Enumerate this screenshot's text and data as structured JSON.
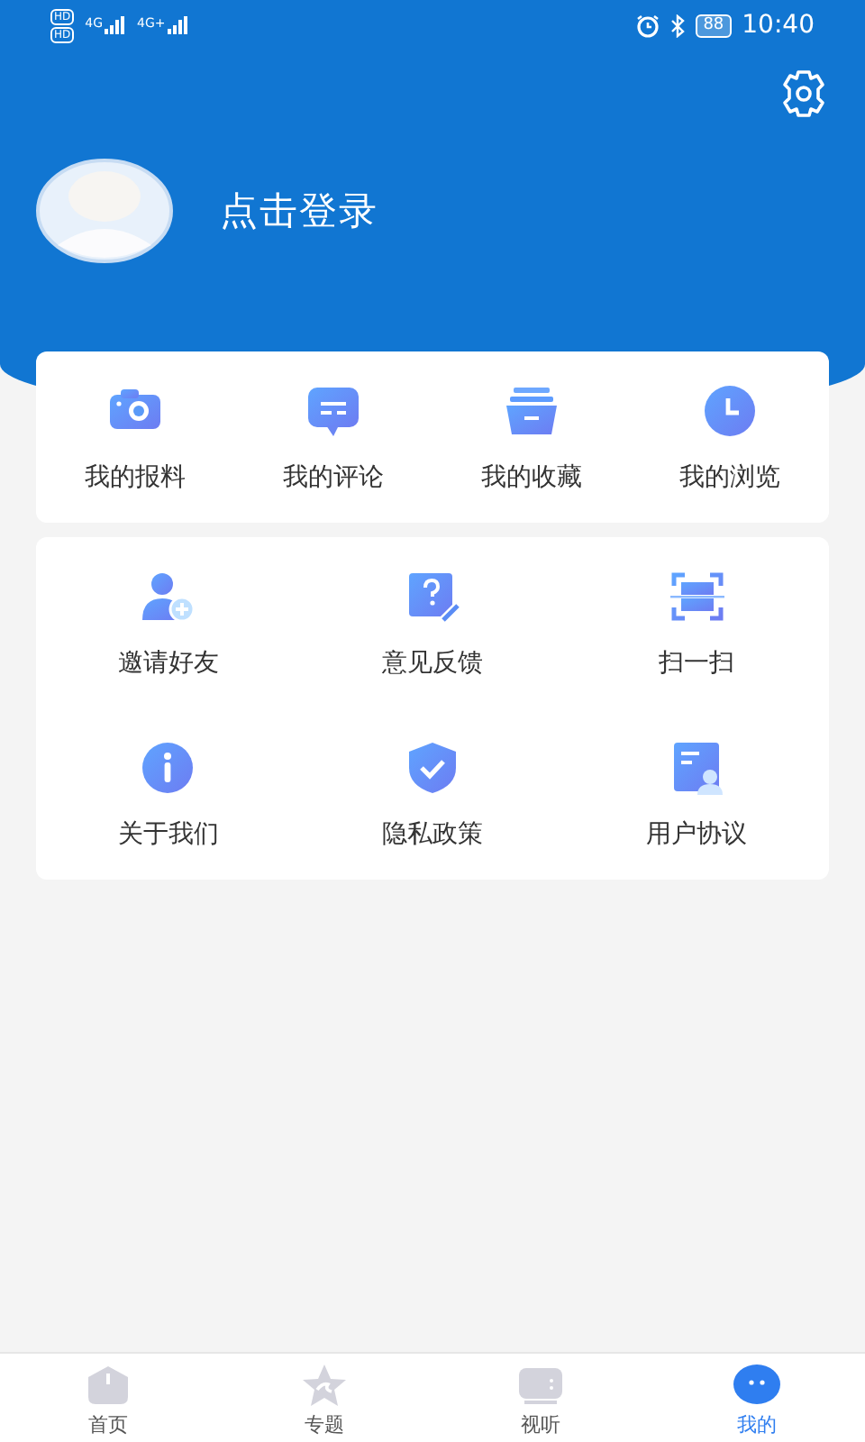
{
  "status_bar": {
    "sim_badges": [
      "HD",
      "HD"
    ],
    "networks": [
      "4G",
      "4G+"
    ],
    "battery": "88",
    "time": "10:40"
  },
  "profile": {
    "login_text": "点击登录"
  },
  "quick_actions": [
    {
      "label": "我的报料",
      "kind": "camera"
    },
    {
      "label": "我的评论",
      "kind": "comment"
    },
    {
      "label": "我的收藏",
      "kind": "archive"
    },
    {
      "label": "我的浏览",
      "kind": "clock"
    }
  ],
  "services": [
    {
      "label": "邀请好友",
      "kind": "invite"
    },
    {
      "label": "意见反馈",
      "kind": "feedback"
    },
    {
      "label": "扫一扫",
      "kind": "scan"
    },
    {
      "label": "关于我们",
      "kind": "info"
    },
    {
      "label": "隐私政策",
      "kind": "shield"
    },
    {
      "label": "用户协议",
      "kind": "agreement"
    }
  ],
  "tab_bar": [
    {
      "label": "首页",
      "kind": "home",
      "selected": false
    },
    {
      "label": "专题",
      "kind": "star",
      "selected": false
    },
    {
      "label": "视听",
      "kind": "tv",
      "selected": false
    },
    {
      "label": "我的",
      "kind": "me",
      "selected": true
    }
  ]
}
